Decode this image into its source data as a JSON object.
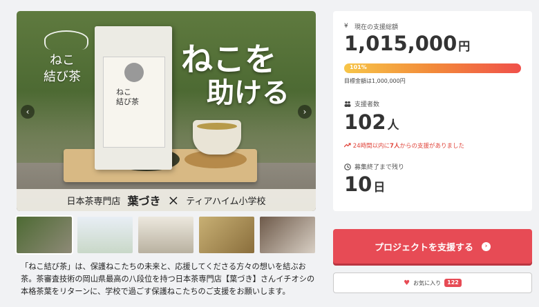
{
  "hero": {
    "brand_title": "ねこ\n結び茶",
    "headline_1": "ねこを",
    "headline_2": "助ける",
    "bag_label": "ねこ\n結び茶",
    "banner_left": "日本茶専門店",
    "banner_shop": "葉づき",
    "banner_cross": "×",
    "banner_right": "ティアハイム小学校",
    "prev_arrow": "‹",
    "next_arrow": "›"
  },
  "thumbnails": [
    "thumb-1",
    "thumb-2",
    "thumb-3",
    "thumb-4",
    "thumb-5"
  ],
  "description": "「ねこ結び茶」は、保護ねこたちの未来と、応援してくださる方々の想いを結ぶお茶。茶審査技術の岡山県最高の八段位を持つ日本茶専門店【葉づき】さんイチオシの本格茶葉をリターンに、学校で過ごす保護ねこたちのご支援をお願いします。",
  "stats": {
    "total_label": "現在の支援総額",
    "total_icon": "¥",
    "total_value": "1,015,000",
    "total_unit": "円",
    "progress_text": "101%",
    "progress_value": 101,
    "target_text": "目標金額は1,000,000円",
    "supporters_label": "支援者数",
    "supporters_value": "102",
    "supporters_unit": "人",
    "recent_text_pre": "24時間以内に",
    "recent_count": "7人",
    "recent_text_post": "からの支援がありました",
    "remaining_label": "募集終了まで残り",
    "remaining_value": "10",
    "remaining_unit": "日"
  },
  "actions": {
    "support_label": "プロジェクトを支援する",
    "favorite_label": "お気に入り",
    "favorite_count": "122"
  },
  "colors": {
    "accent": "#e74b55",
    "alert": "#e0463c"
  }
}
